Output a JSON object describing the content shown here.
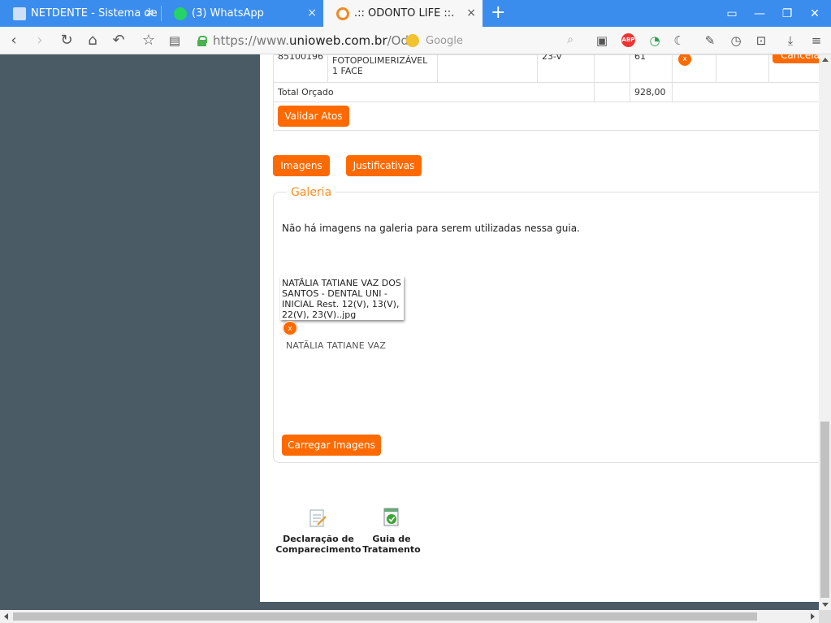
{
  "browser": {
    "tabs": [
      {
        "title": "NETDENTE - Sistema de",
        "close": "×"
      },
      {
        "title": "(3) WhatsApp",
        "close": "×"
      },
      {
        "title": ".:: ODONTO LIFE ::.",
        "close": "×"
      }
    ],
    "new_tab": "+",
    "url_prefix": "https://www.",
    "url_domain": "unioweb.com.br",
    "url_path": "/Odo",
    "search_placeholder": "Google",
    "abp_label": "ABP"
  },
  "table": {
    "row": {
      "code": "85100196",
      "procedure": "FOTOPOLIMERIZÁVEL 1 FACE",
      "tooth": "23-V",
      "value": "61",
      "remove": "x",
      "cancel": "Cancelar"
    },
    "total_label": "Total Orçado",
    "total_value": "928,00"
  },
  "buttons": {
    "validate": "Validar Atos",
    "images": "Imagens",
    "justifications": "Justificativas",
    "upload": "Carregar Imagens"
  },
  "gallery": {
    "legend": "Galeria",
    "empty_message": "Não há imagens na galeria para serem utilizadas nessa guia.",
    "thumb_caption": "NATÃLIA TATIANE VAZ DOS SANTOS - DENTAL UNI - INICIAL Rest. 12(V), 13(V), 22(V), 23(V)..jpg",
    "thumb_remove": "x",
    "file_label": "NATÃLIA TATIANE VAZ"
  },
  "documents": [
    {
      "label_line1": "Declaração de",
      "label_line2": "Comparecimento",
      "icon": "document-pencil-icon"
    },
    {
      "label_line1": "Guia de",
      "label_line2": "Tratamento",
      "icon": "checked-document-icon"
    }
  ],
  "colors": {
    "accent": "#ff6a00",
    "tabbar": "#3b8ded",
    "sidebar": "#4a5b66",
    "legend": "#ff8a1f"
  }
}
